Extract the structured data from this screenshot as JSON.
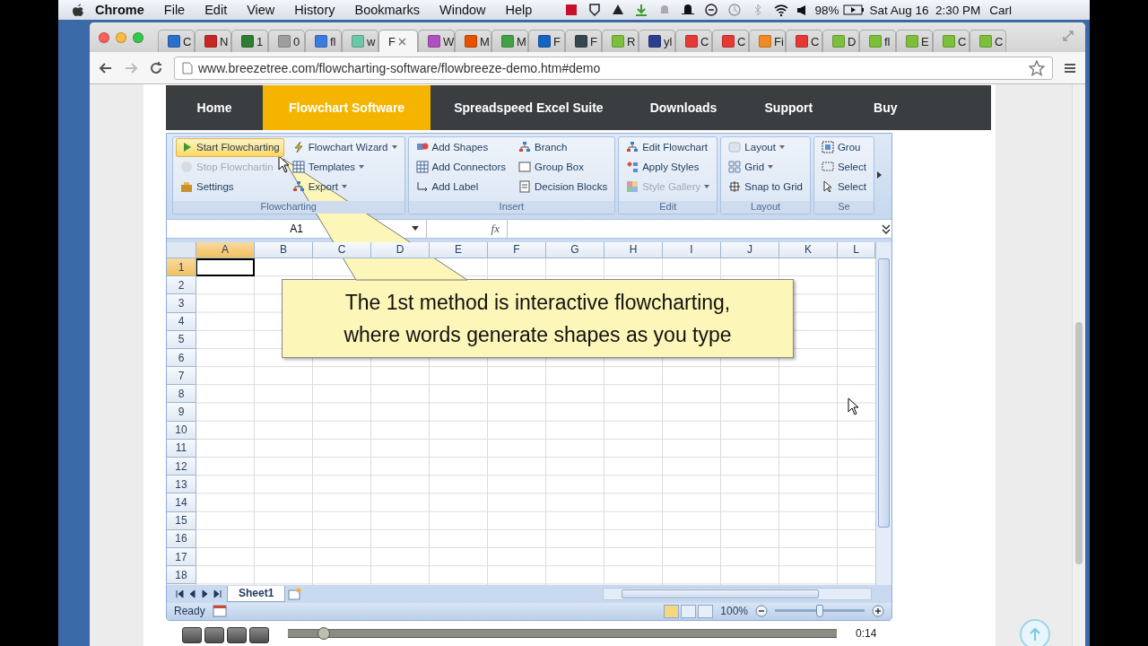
{
  "menu_bar": {
    "app": "Chrome",
    "menus": [
      "File",
      "Edit",
      "View",
      "History",
      "Bookmarks",
      "Window",
      "Help"
    ],
    "battery": "98%",
    "clock": "Sat Aug 16  2:30 PM",
    "user": "Carl"
  },
  "tabs": [
    {
      "title": "C",
      "color": "#2a6fc9",
      "selected": false
    },
    {
      "title": "N",
      "color": "#c62828",
      "selected": false
    },
    {
      "title": "1",
      "color": "#2e7d32",
      "selected": false
    },
    {
      "title": "0",
      "color": "#9e9e9e",
      "selected": false
    },
    {
      "title": "fl",
      "color": "#3b7be0",
      "selected": false
    },
    {
      "title": "w",
      "color": "#6cc7a8",
      "selected": false
    },
    {
      "title": "F",
      "selected": true
    },
    {
      "title": "W",
      "color": "#b050c0",
      "selected": false
    },
    {
      "title": "M",
      "color": "#e65100",
      "selected": false
    },
    {
      "title": "M",
      "color": "#43a047",
      "selected": false
    },
    {
      "title": "F",
      "color": "#1565c0",
      "selected": false
    },
    {
      "title": "F",
      "color": "#37474f",
      "selected": false
    },
    {
      "title": "R",
      "color": "#7cbf3a",
      "selected": false
    },
    {
      "title": "yl",
      "color": "#2a3f8f",
      "selected": false
    },
    {
      "title": "C",
      "color": "#e53935",
      "selected": false
    },
    {
      "title": "C",
      "color": "#e53935",
      "selected": false
    },
    {
      "title": "Fi",
      "color": "#f08a24",
      "selected": false
    },
    {
      "title": "C",
      "color": "#e53935",
      "selected": false
    },
    {
      "title": "D",
      "color": "#7cbf3a",
      "selected": false
    },
    {
      "title": "fl",
      "color": "#7cbf3a",
      "selected": false
    },
    {
      "title": "E",
      "color": "#7cbf3a",
      "selected": false
    },
    {
      "title": "C",
      "color": "#7cbf3a",
      "selected": false
    },
    {
      "title": "C",
      "color": "#7cbf3a",
      "selected": false
    }
  ],
  "address": "www.breezetree.com/flowcharting-software/flowbreeze-demo.htm#demo",
  "site_nav": [
    {
      "label": "Home",
      "selected": false
    },
    {
      "label": "Flowchart Software",
      "selected": true
    },
    {
      "label": "Spreadspeed Excel Suite",
      "selected": false
    },
    {
      "label": "Downloads",
      "selected": false
    },
    {
      "label": "Support",
      "selected": false
    },
    {
      "label": "Buy",
      "selected": false
    }
  ],
  "ribbon": [
    {
      "label": "Flowcharting",
      "columns": [
        [
          {
            "label": "Start Flowcharting",
            "dropdown": false,
            "disabled": false,
            "hovered": true
          },
          {
            "label": "Stop Flowchartin",
            "dropdown": false,
            "disabled": true,
            "hovered": false
          },
          {
            "label": "Settings",
            "dropdown": false,
            "disabled": false,
            "hovered": false
          }
        ],
        [
          {
            "label": "Flowchart Wizard",
            "dropdown": true,
            "disabled": false,
            "hovered": false
          },
          {
            "label": "Templates",
            "dropdown": true,
            "disabled": false,
            "hovered": false
          },
          {
            "label": "Export",
            "dropdown": true,
            "disabled": false,
            "hovered": false
          }
        ]
      ]
    },
    {
      "label": "Insert",
      "columns": [
        [
          {
            "label": "Add Shapes",
            "dropdown": false,
            "disabled": false,
            "hovered": false
          },
          {
            "label": "Add Connectors",
            "dropdown": false,
            "disabled": false,
            "hovered": false
          },
          {
            "label": "Add Label",
            "dropdown": false,
            "disabled": false,
            "hovered": false
          }
        ],
        [
          {
            "label": "Branch",
            "dropdown": false,
            "disabled": false,
            "hovered": false
          },
          {
            "label": "Group Box",
            "dropdown": false,
            "disabled": false,
            "hovered": false
          },
          {
            "label": "Decision Blocks",
            "dropdown": false,
            "disabled": false,
            "hovered": false
          }
        ]
      ]
    },
    {
      "label": "Edit",
      "columns": [
        [
          {
            "label": "Edit Flowchart",
            "dropdown": false,
            "disabled": false,
            "hovered": false
          },
          {
            "label": "Apply Styles",
            "dropdown": false,
            "disabled": false,
            "hovered": false
          },
          {
            "label": "Style Gallery",
            "dropdown": true,
            "disabled": true,
            "hovered": false
          }
        ]
      ]
    },
    {
      "label": "Layout",
      "columns": [
        [
          {
            "label": "Layout",
            "dropdown": true,
            "disabled": false,
            "hovered": false
          },
          {
            "label": "Grid",
            "dropdown": true,
            "disabled": false,
            "hovered": false
          },
          {
            "label": "Snap to Grid",
            "dropdown": false,
            "disabled": false,
            "hovered": false
          }
        ]
      ]
    },
    {
      "label": "Se",
      "columns": [
        [
          {
            "label": "Grou",
            "dropdown": false,
            "disabled": false,
            "hovered": false
          },
          {
            "label": "Select",
            "dropdown": false,
            "disabled": false,
            "hovered": false
          },
          {
            "label": "Select",
            "dropdown": false,
            "disabled": false,
            "hovered": false
          }
        ]
      ]
    }
  ],
  "formula_bar": {
    "name_box": "A1",
    "fx": "fx"
  },
  "sheet": {
    "columns": [
      {
        "label": "A",
        "selected": true
      },
      {
        "label": "B",
        "selected": false
      },
      {
        "label": "C",
        "selected": false
      },
      {
        "label": "D",
        "selected": false
      },
      {
        "label": "E",
        "selected": false
      },
      {
        "label": "F",
        "selected": false
      },
      {
        "label": "G",
        "selected": false
      },
      {
        "label": "H",
        "selected": false
      },
      {
        "label": "I",
        "selected": false
      },
      {
        "label": "J",
        "selected": false
      },
      {
        "label": "K",
        "selected": false
      },
      {
        "label": "L",
        "selected": false
      }
    ],
    "rows": [
      {
        "label": "1",
        "selected": true
      },
      {
        "label": "2",
        "selected": false
      },
      {
        "label": "3",
        "selected": false
      },
      {
        "label": "4",
        "selected": false
      },
      {
        "label": "5",
        "selected": false
      },
      {
        "label": "6",
        "selected": false
      },
      {
        "label": "7",
        "selected": false
      },
      {
        "label": "8",
        "selected": false
      },
      {
        "label": "9",
        "selected": false
      },
      {
        "label": "10",
        "selected": false
      },
      {
        "label": "11",
        "selected": false
      },
      {
        "label": "12",
        "selected": false
      },
      {
        "label": "13",
        "selected": false
      },
      {
        "label": "14",
        "selected": false
      },
      {
        "label": "15",
        "selected": false
      },
      {
        "label": "16",
        "selected": false
      },
      {
        "label": "17",
        "selected": false
      },
      {
        "label": "18",
        "selected": false
      }
    ]
  },
  "sheet_tabs": [
    {
      "label": "Sheet1",
      "selected": true
    }
  ],
  "status_bar": {
    "status": "Ready",
    "zoom": "100%",
    "zoom_slider": {
      "level": 0.5
    }
  },
  "callout": {
    "text": "The 1st method is interactive flowcharting,\nwhere words generate shapes as you type"
  },
  "video": {
    "position": {
      "level": 0.066
    },
    "time": "0:14"
  }
}
